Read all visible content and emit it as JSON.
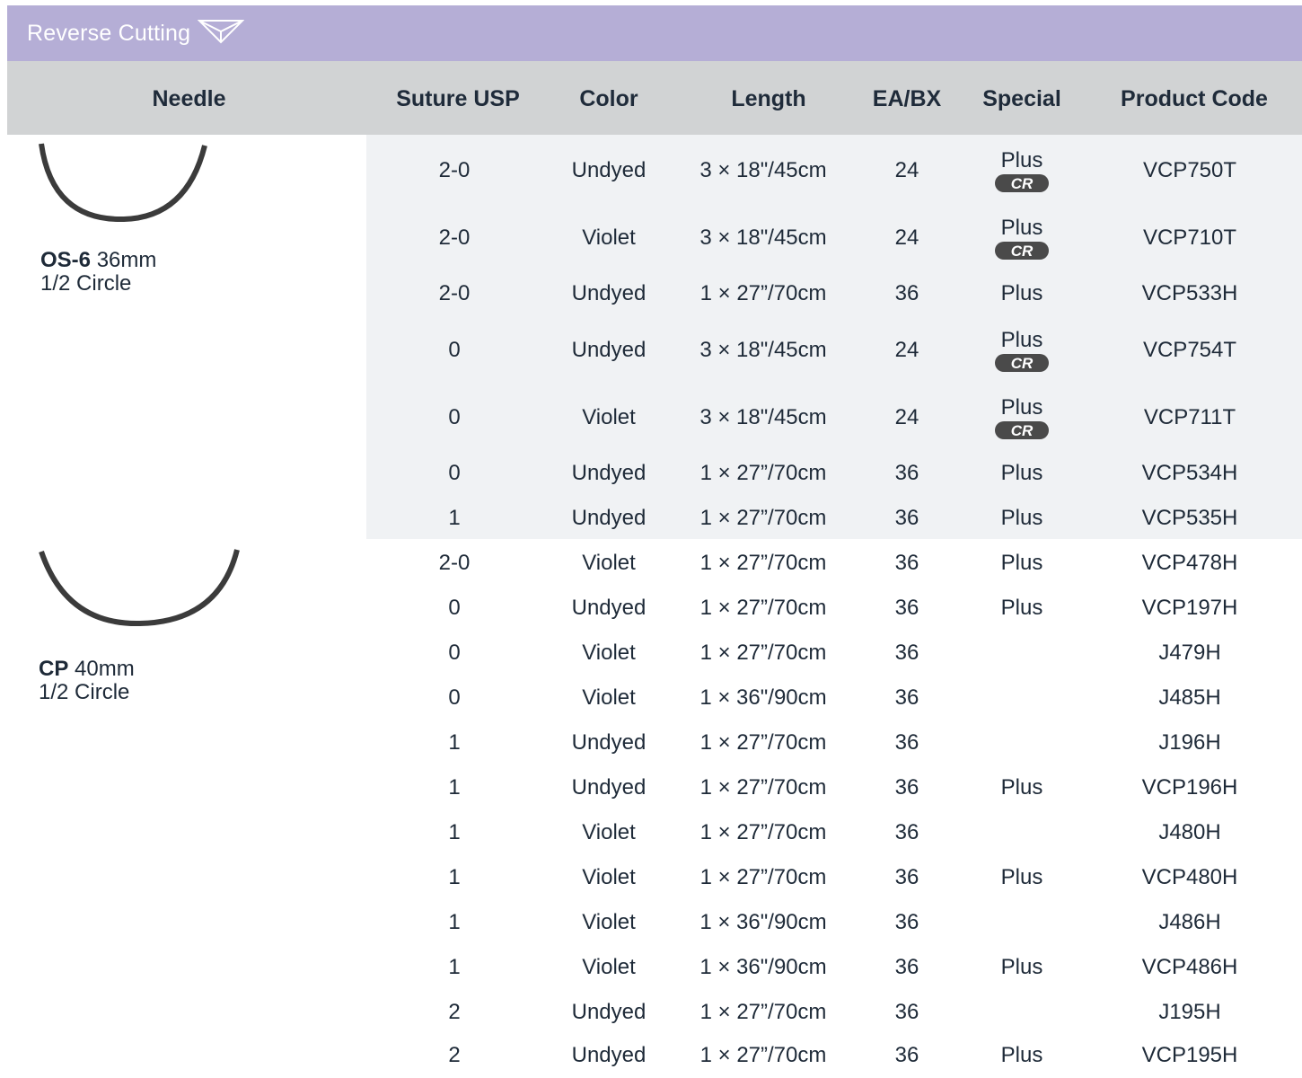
{
  "banner": {
    "title": "Reverse Cutting",
    "icon": "needle-cross-section-icon"
  },
  "header": {
    "needle": "Needle",
    "usp": "Suture USP",
    "color": "Color",
    "length": "Length",
    "ea": "EA/BX",
    "special": "Special",
    "code": "Product Code"
  },
  "needles": [
    {
      "name": "OS-6",
      "size": "36mm",
      "shape": "1/2 Circle"
    },
    {
      "name": "CP",
      "size": "40mm",
      "shape": "1/2 Circle"
    }
  ],
  "rows": [
    {
      "usp": "2-0",
      "color": "Undyed",
      "length": "3 × 18\"/45cm",
      "ea": "24",
      "special": "Plus",
      "cr": "CR",
      "code": "VCP750T"
    },
    {
      "usp": "2-0",
      "color": "Violet",
      "length": "3 × 18\"/45cm",
      "ea": "24",
      "special": "Plus",
      "cr": "CR",
      "code": "VCP710T"
    },
    {
      "usp": "2-0",
      "color": "Undyed",
      "length": "1 × 27”/70cm",
      "ea": "36",
      "special": "Plus",
      "cr": "",
      "code": "VCP533H"
    },
    {
      "usp": "0",
      "color": "Undyed",
      "length": "3 × 18\"/45cm",
      "ea": "24",
      "special": "Plus",
      "cr": "CR",
      "code": "VCP754T"
    },
    {
      "usp": "0",
      "color": "Violet",
      "length": "3 × 18\"/45cm",
      "ea": "24",
      "special": "Plus",
      "cr": "CR",
      "code": "VCP711T"
    },
    {
      "usp": "0",
      "color": "Undyed",
      "length": "1 × 27”/70cm",
      "ea": "36",
      "special": "Plus",
      "cr": "",
      "code": "VCP534H"
    },
    {
      "usp": "1",
      "color": "Undyed",
      "length": "1 × 27”/70cm",
      "ea": "36",
      "special": "Plus",
      "cr": "",
      "code": "VCP535H"
    },
    {
      "usp": "2-0",
      "color": "Violet",
      "length": "1 × 27”/70cm",
      "ea": "36",
      "special": "Plus",
      "cr": "",
      "code": "VCP478H"
    },
    {
      "usp": "0",
      "color": "Undyed",
      "length": "1 × 27”/70cm",
      "ea": "36",
      "special": "Plus",
      "cr": "",
      "code": "VCP197H"
    },
    {
      "usp": "0",
      "color": "Violet",
      "length": "1 × 27”/70cm",
      "ea": "36",
      "special": "",
      "cr": "",
      "code": "J479H"
    },
    {
      "usp": "0",
      "color": "Violet",
      "length": "1 × 36\"/90cm",
      "ea": "36",
      "special": "",
      "cr": "",
      "code": "J485H"
    },
    {
      "usp": "1",
      "color": "Undyed",
      "length": "1 × 27”/70cm",
      "ea": "36",
      "special": "",
      "cr": "",
      "code": "J196H"
    },
    {
      "usp": "1",
      "color": "Undyed",
      "length": "1 × 27”/70cm",
      "ea": "36",
      "special": "Plus",
      "cr": "",
      "code": "VCP196H"
    },
    {
      "usp": "1",
      "color": "Violet",
      "length": "1 × 27”/70cm",
      "ea": "36",
      "special": "",
      "cr": "",
      "code": "J480H"
    },
    {
      "usp": "1",
      "color": "Violet",
      "length": "1 × 27”/70cm",
      "ea": "36",
      "special": "Plus",
      "cr": "",
      "code": "VCP480H"
    },
    {
      "usp": "1",
      "color": "Violet",
      "length": "1 × 36\"/90cm",
      "ea": "36",
      "special": "",
      "cr": "",
      "code": "J486H"
    },
    {
      "usp": "1",
      "color": "Violet",
      "length": "1 × 36\"/90cm",
      "ea": "36",
      "special": "Plus",
      "cr": "",
      "code": "VCP486H"
    },
    {
      "usp": "2",
      "color": "Undyed",
      "length": "1 × 27”/70cm",
      "ea": "36",
      "special": "",
      "cr": "",
      "code": "J195H"
    },
    {
      "usp": "2",
      "color": "Undyed",
      "length": "1 × 27”/70cm",
      "ea": "36",
      "special": "Plus",
      "cr": "",
      "code": "VCP195H"
    }
  ],
  "colors": {
    "banner": "#b5aed6",
    "header": "#d1d3d4",
    "shade": "#f0f2f4",
    "text": "#1e2a38",
    "badge": "#4a4a4a"
  }
}
